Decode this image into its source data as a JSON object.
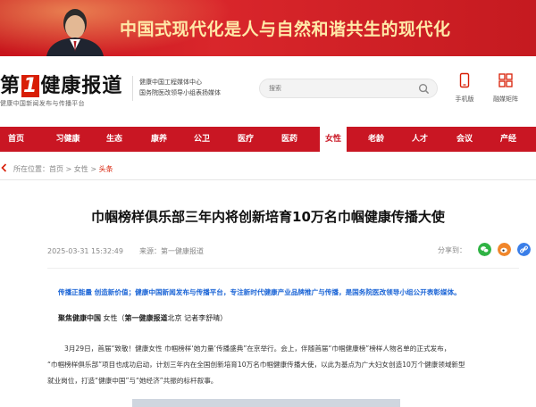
{
  "banner": {
    "slogan": "中国式现代化是人与自然和谐共生的现代化"
  },
  "header": {
    "logo_prefix": "第",
    "logo_one": "1",
    "logo_rest": "健康报道",
    "logo_tagline": "健康中国新闻发布与传播平台",
    "sub_line1": "健康中国工程媒体中心",
    "sub_line2": "国务院医改领导小组表扬媒体",
    "search_placeholder": "搜索",
    "tool_mobile": "手机版",
    "tool_app": "融媒矩阵"
  },
  "nav": {
    "items": [
      {
        "label": "首页"
      },
      {
        "label": "习健康"
      },
      {
        "label": "生态"
      },
      {
        "label": "康养"
      },
      {
        "label": "公卫"
      },
      {
        "label": "医疗"
      },
      {
        "label": "医药"
      },
      {
        "label": "女性"
      },
      {
        "label": "老龄"
      },
      {
        "label": "人才"
      },
      {
        "label": "会议"
      },
      {
        "label": "产经"
      }
    ],
    "active": "女性"
  },
  "breadcrumb": {
    "prefix": "所在位置：",
    "home": "首页",
    "sep": " > ",
    "section": "女性",
    "current": "头条"
  },
  "article": {
    "title": "巾帼榜样俱乐部三年内将创新培育10万名巾帼健康传播大使",
    "date": "2025-03-31 15:32:49",
    "source": "来源：第一健康报道",
    "share_label": "分享到：",
    "summary": "传播正能量 创造新价值；健康中国新闻发布与传播平台，专注新时代健康产业品牌推广与传播，是国务院医改领导小组公开表彰媒体。",
    "byline_bold1": "聚焦健康中国",
    "byline_text1": " 女性（",
    "byline_bold2": "第一健康报道",
    "byline_text2": "北京 记者李舒晴）",
    "para1": "3月29日，首届“致敬！健康女性 巾帼榜样‘她力量’传播盛典”在京举行。会上，伴随首届“巾帼健康榜”榜样人物名单的正式发布，",
    "para2": "“巾帼榜样俱乐部”项目也成功启动，计划三年内在全国创新培育10万名巾帼健康传播大使，以此为基点为广大妇女创造10万个健康领域新型",
    "para3": "就业岗位，打造“健康中国”与“她经济”共振的标杆叙事。"
  },
  "colors": {
    "brand_red": "#c91623",
    "summary_blue": "#1a64d6",
    "wechat_green": "#2fb344",
    "weibo_orange": "#f0862b",
    "link_blue": "#3a7ee8"
  }
}
